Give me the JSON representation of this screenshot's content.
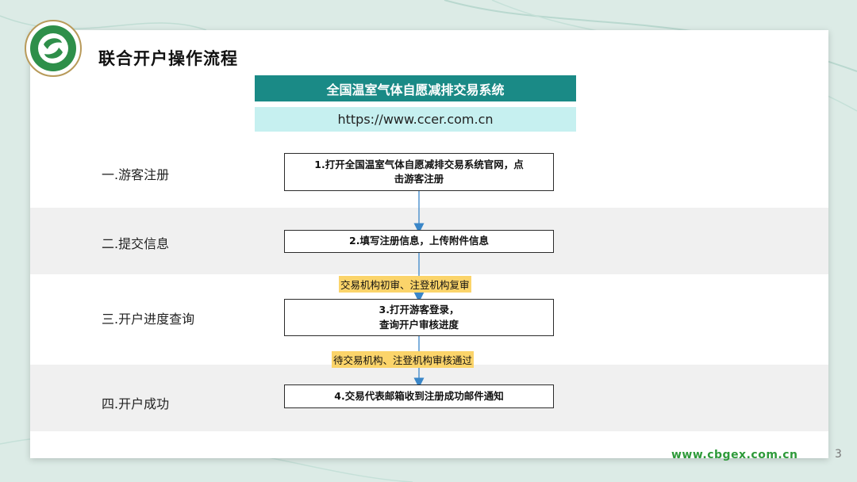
{
  "title": "联合开户操作流程",
  "system": {
    "name": "全国温室气体自愿减排交易系统",
    "url": "https://www.ccer.com.cn"
  },
  "stages": [
    {
      "label": "一.游客注册"
    },
    {
      "label": "二.提交信息"
    },
    {
      "label": "三.开户进度查询"
    },
    {
      "label": "四.开户成功"
    }
  ],
  "steps": [
    {
      "line1": "1.打开全国温室气体自愿减排交易系统官网，点",
      "line2": "击游客注册"
    },
    {
      "line1": "2.填写注册信息，上传附件信息"
    },
    {
      "line1": "3.打开游客登录，",
      "line2": "查询开户审核进度"
    },
    {
      "line1": "4.交易代表邮箱收到注册成功邮件通知"
    }
  ],
  "notes": [
    "交易机构初审、注登机构复审",
    "待交易机构、注登机构审核通过"
  ],
  "footer": {
    "url": "www.cbgex.com.cn",
    "page_number": "3"
  },
  "colors": {
    "header_teal": "#1a8a86",
    "url_bar": "#c6f0f0",
    "note_highlight": "#fbd46a",
    "arrow": "#3a86c8",
    "footer_green": "#2e9a3a"
  },
  "icons": {
    "logo": "circular-green-emblem-icon"
  }
}
